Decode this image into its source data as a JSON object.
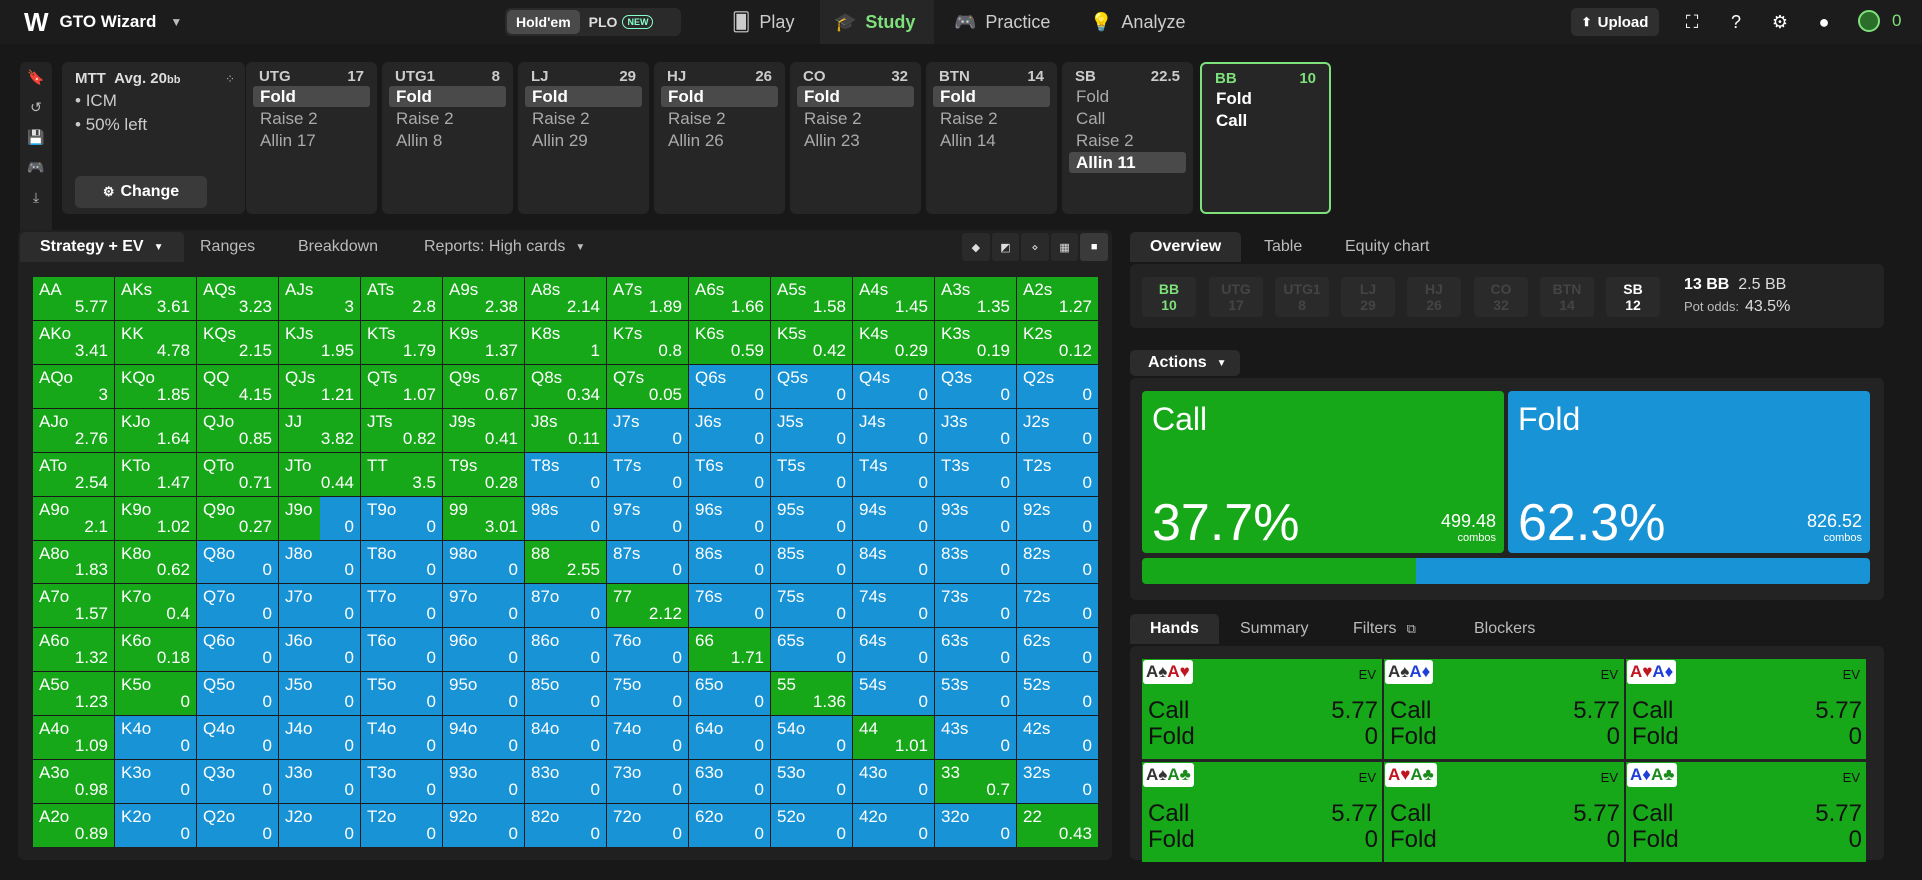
{
  "nav": {
    "logo": "W",
    "app_name": "GTO Wizard",
    "game_toggle": [
      "Hold'em",
      "PLO"
    ],
    "new_badge": "NEW",
    "items": [
      "Play",
      "Study",
      "Practice",
      "Analyze"
    ],
    "upload": "Upload",
    "coins": "0"
  },
  "mtt": {
    "title": "MTT",
    "avg": "Avg. 20",
    "avg_unit": "bb",
    "lines": [
      "ICM",
      "50% left"
    ],
    "change": "Change"
  },
  "positions": [
    {
      "name": "UTG",
      "stack": "17",
      "actions": [
        "Fold",
        "Raise 2",
        "Allin 17"
      ],
      "selected": 0
    },
    {
      "name": "UTG1",
      "stack": "8",
      "actions": [
        "Fold",
        "Raise 2",
        "Allin 8"
      ],
      "selected": 0
    },
    {
      "name": "LJ",
      "stack": "29",
      "actions": [
        "Fold",
        "Raise 2",
        "Allin 29"
      ],
      "selected": 0
    },
    {
      "name": "HJ",
      "stack": "26",
      "actions": [
        "Fold",
        "Raise 2",
        "Allin 26"
      ],
      "selected": 0
    },
    {
      "name": "CO",
      "stack": "32",
      "actions": [
        "Fold",
        "Raise 2",
        "Allin 23"
      ],
      "selected": 0
    },
    {
      "name": "BTN",
      "stack": "14",
      "actions": [
        "Fold",
        "Raise 2",
        "Allin 14"
      ],
      "selected": 0
    },
    {
      "name": "SB",
      "stack": "22.5",
      "actions": [
        "Fold",
        "Call",
        "Raise 2",
        "Allin 11"
      ],
      "selected": 3
    },
    {
      "name": "BB",
      "stack": "10",
      "actions": [
        "Fold",
        "Call"
      ],
      "selected": -1
    }
  ],
  "left_tabs": [
    "Strategy + EV",
    "Ranges",
    "Breakdown",
    "Reports: High cards"
  ],
  "colors": {
    "call": "#16a818",
    "fold": "#1893d6"
  },
  "grid": {
    "rows": [
      [
        [
          "AA",
          "5.77",
          1
        ],
        [
          "AKs",
          "3.61",
          1
        ],
        [
          "AQs",
          "3.23",
          1
        ],
        [
          "AJs",
          "3",
          1
        ],
        [
          "ATs",
          "2.8",
          1
        ],
        [
          "A9s",
          "2.38",
          1
        ],
        [
          "A8s",
          "2.14",
          1
        ],
        [
          "A7s",
          "1.89",
          1
        ],
        [
          "A6s",
          "1.66",
          1
        ],
        [
          "A5s",
          "1.58",
          1
        ],
        [
          "A4s",
          "1.45",
          1
        ],
        [
          "A3s",
          "1.35",
          1
        ],
        [
          "A2s",
          "1.27",
          1
        ]
      ],
      [
        [
          "AKo",
          "3.41",
          1
        ],
        [
          "KK",
          "4.78",
          1
        ],
        [
          "KQs",
          "2.15",
          1
        ],
        [
          "KJs",
          "1.95",
          1
        ],
        [
          "KTs",
          "1.79",
          1
        ],
        [
          "K9s",
          "1.37",
          1
        ],
        [
          "K8s",
          "1",
          1
        ],
        [
          "K7s",
          "0.8",
          1
        ],
        [
          "K6s",
          "0.59",
          1
        ],
        [
          "K5s",
          "0.42",
          1
        ],
        [
          "K4s",
          "0.29",
          1
        ],
        [
          "K3s",
          "0.19",
          1
        ],
        [
          "K2s",
          "0.12",
          1
        ]
      ],
      [
        [
          "AQo",
          "3",
          1
        ],
        [
          "KQo",
          "1.85",
          1
        ],
        [
          "QQ",
          "4.15",
          1
        ],
        [
          "QJs",
          "1.21",
          1
        ],
        [
          "QTs",
          "1.07",
          1
        ],
        [
          "Q9s",
          "0.67",
          1
        ],
        [
          "Q8s",
          "0.34",
          1
        ],
        [
          "Q7s",
          "0.05",
          1
        ],
        [
          "Q6s",
          "0",
          0
        ],
        [
          "Q5s",
          "0",
          0
        ],
        [
          "Q4s",
          "0",
          0
        ],
        [
          "Q3s",
          "0",
          0
        ],
        [
          "Q2s",
          "0",
          0
        ]
      ],
      [
        [
          "AJo",
          "2.76",
          1
        ],
        [
          "KJo",
          "1.64",
          1
        ],
        [
          "QJo",
          "0.85",
          1
        ],
        [
          "JJ",
          "3.82",
          1
        ],
        [
          "JTs",
          "0.82",
          1
        ],
        [
          "J9s",
          "0.41",
          1
        ],
        [
          "J8s",
          "0.11",
          1
        ],
        [
          "J7s",
          "0",
          0
        ],
        [
          "J6s",
          "0",
          0
        ],
        [
          "J5s",
          "0",
          0
        ],
        [
          "J4s",
          "0",
          0
        ],
        [
          "J3s",
          "0",
          0
        ],
        [
          "J2s",
          "0",
          0
        ]
      ],
      [
        [
          "ATo",
          "2.54",
          1
        ],
        [
          "KTo",
          "1.47",
          1
        ],
        [
          "QTo",
          "0.71",
          1
        ],
        [
          "JTo",
          "0.44",
          1
        ],
        [
          "TT",
          "3.5",
          1
        ],
        [
          "T9s",
          "0.28",
          1
        ],
        [
          "T8s",
          "0",
          0
        ],
        [
          "T7s",
          "0",
          0
        ],
        [
          "T6s",
          "0",
          0
        ],
        [
          "T5s",
          "0",
          0
        ],
        [
          "T4s",
          "0",
          0
        ],
        [
          "T3s",
          "0",
          0
        ],
        [
          "T2s",
          "0",
          0
        ]
      ],
      [
        [
          "A9o",
          "2.1",
          1
        ],
        [
          "K9o",
          "1.02",
          1
        ],
        [
          "Q9o",
          "0.27",
          1
        ],
        [
          "J9o",
          "0",
          0.5
        ],
        [
          "T9o",
          "0",
          0
        ],
        [
          "99",
          "3.01",
          1
        ],
        [
          "98s",
          "0",
          0
        ],
        [
          "97s",
          "0",
          0
        ],
        [
          "96s",
          "0",
          0
        ],
        [
          "95s",
          "0",
          0
        ],
        [
          "94s",
          "0",
          0
        ],
        [
          "93s",
          "0",
          0
        ],
        [
          "92s",
          "0",
          0
        ]
      ],
      [
        [
          "A8o",
          "1.83",
          1
        ],
        [
          "K8o",
          "0.62",
          1
        ],
        [
          "Q8o",
          "0",
          0
        ],
        [
          "J8o",
          "0",
          0
        ],
        [
          "T8o",
          "0",
          0
        ],
        [
          "98o",
          "0",
          0
        ],
        [
          "88",
          "2.55",
          1
        ],
        [
          "87s",
          "0",
          0
        ],
        [
          "86s",
          "0",
          0
        ],
        [
          "85s",
          "0",
          0
        ],
        [
          "84s",
          "0",
          0
        ],
        [
          "83s",
          "0",
          0
        ],
        [
          "82s",
          "0",
          0
        ]
      ],
      [
        [
          "A7o",
          "1.57",
          1
        ],
        [
          "K7o",
          "0.4",
          1
        ],
        [
          "Q7o",
          "0",
          0
        ],
        [
          "J7o",
          "0",
          0
        ],
        [
          "T7o",
          "0",
          0
        ],
        [
          "97o",
          "0",
          0
        ],
        [
          "87o",
          "0",
          0
        ],
        [
          "77",
          "2.12",
          1
        ],
        [
          "76s",
          "0",
          0
        ],
        [
          "75s",
          "0",
          0
        ],
        [
          "74s",
          "0",
          0
        ],
        [
          "73s",
          "0",
          0
        ],
        [
          "72s",
          "0",
          0
        ]
      ],
      [
        [
          "A6o",
          "1.32",
          1
        ],
        [
          "K6o",
          "0.18",
          1
        ],
        [
          "Q6o",
          "0",
          0
        ],
        [
          "J6o",
          "0",
          0
        ],
        [
          "T6o",
          "0",
          0
        ],
        [
          "96o",
          "0",
          0
        ],
        [
          "86o",
          "0",
          0
        ],
        [
          "76o",
          "0",
          0
        ],
        [
          "66",
          "1.71",
          1
        ],
        [
          "65s",
          "0",
          0
        ],
        [
          "64s",
          "0",
          0
        ],
        [
          "63s",
          "0",
          0
        ],
        [
          "62s",
          "0",
          0
        ]
      ],
      [
        [
          "A5o",
          "1.23",
          1
        ],
        [
          "K5o",
          "0",
          1
        ],
        [
          "Q5o",
          "0",
          0
        ],
        [
          "J5o",
          "0",
          0
        ],
        [
          "T5o",
          "0",
          0
        ],
        [
          "95o",
          "0",
          0
        ],
        [
          "85o",
          "0",
          0
        ],
        [
          "75o",
          "0",
          0
        ],
        [
          "65o",
          "0",
          0
        ],
        [
          "55",
          "1.36",
          1
        ],
        [
          "54s",
          "0",
          0
        ],
        [
          "53s",
          "0",
          0
        ],
        [
          "52s",
          "0",
          0
        ]
      ],
      [
        [
          "A4o",
          "1.09",
          1
        ],
        [
          "K4o",
          "0",
          0
        ],
        [
          "Q4o",
          "0",
          0
        ],
        [
          "J4o",
          "0",
          0
        ],
        [
          "T4o",
          "0",
          0
        ],
        [
          "94o",
          "0",
          0
        ],
        [
          "84o",
          "0",
          0
        ],
        [
          "74o",
          "0",
          0
        ],
        [
          "64o",
          "0",
          0
        ],
        [
          "54o",
          "0",
          0
        ],
        [
          "44",
          "1.01",
          1
        ],
        [
          "43s",
          "0",
          0
        ],
        [
          "42s",
          "0",
          0
        ]
      ],
      [
        [
          "A3o",
          "0.98",
          1
        ],
        [
          "K3o",
          "0",
          0
        ],
        [
          "Q3o",
          "0",
          0
        ],
        [
          "J3o",
          "0",
          0
        ],
        [
          "T3o",
          "0",
          0
        ],
        [
          "93o",
          "0",
          0
        ],
        [
          "83o",
          "0",
          0
        ],
        [
          "73o",
          "0",
          0
        ],
        [
          "63o",
          "0",
          0
        ],
        [
          "53o",
          "0",
          0
        ],
        [
          "43o",
          "0",
          0
        ],
        [
          "33",
          "0.7",
          1
        ],
        [
          "32s",
          "0",
          0
        ]
      ],
      [
        [
          "A2o",
          "0.89",
          1
        ],
        [
          "K2o",
          "0",
          0
        ],
        [
          "Q2o",
          "0",
          0
        ],
        [
          "J2o",
          "0",
          0
        ],
        [
          "T2o",
          "0",
          0
        ],
        [
          "92o",
          "0",
          0
        ],
        [
          "82o",
          "0",
          0
        ],
        [
          "72o",
          "0",
          0
        ],
        [
          "62o",
          "0",
          0
        ],
        [
          "52o",
          "0",
          0
        ],
        [
          "42o",
          "0",
          0
        ],
        [
          "32o",
          "0",
          0
        ],
        [
          "22",
          "0.43",
          1
        ]
      ]
    ]
  },
  "right_tabs": [
    "Overview",
    "Table",
    "Equity chart"
  ],
  "chips": [
    {
      "pos": "BB",
      "stack": "10"
    },
    {
      "pos": "UTG",
      "stack": "17"
    },
    {
      "pos": "UTG1",
      "stack": "8"
    },
    {
      "pos": "LJ",
      "stack": "29"
    },
    {
      "pos": "HJ",
      "stack": "26"
    },
    {
      "pos": "CO",
      "stack": "32"
    },
    {
      "pos": "BTN",
      "stack": "14"
    },
    {
      "pos": "SB",
      "stack": "12"
    }
  ],
  "pot": {
    "total": "13 BB",
    "to_call": "2.5 BB",
    "odds_label": "Pot odds:",
    "odds": "43.5%"
  },
  "actions_label": "Actions",
  "actions": [
    {
      "name": "Call",
      "pct": "37.7%",
      "combos": "499.48",
      "combos_label": "combos",
      "freq": 0.377
    },
    {
      "name": "Fold",
      "pct": "62.3%",
      "combos": "826.52",
      "combos_label": "combos",
      "freq": 0.623
    }
  ],
  "hand_tabs": [
    "Hands",
    "Summary",
    "Filters",
    "Blockers"
  ],
  "hands": [
    {
      "rank1": "A",
      "suit1": "♠",
      "rank2": "A",
      "suit2": "♥",
      "ev": "EV",
      "call_label": "Call",
      "call": "5.77",
      "fold_label": "Fold",
      "fold": "0"
    },
    {
      "rank1": "A",
      "suit1": "♠",
      "rank2": "A",
      "suit2": "♦",
      "ev": "EV",
      "call_label": "Call",
      "call": "5.77",
      "fold_label": "Fold",
      "fold": "0"
    },
    {
      "rank1": "A",
      "suit1": "♥",
      "rank2": "A",
      "suit2": "♦",
      "ev": "EV",
      "call_label": "Call",
      "call": "5.77",
      "fold_label": "Fold",
      "fold": "0"
    },
    {
      "rank1": "A",
      "suit1": "♠",
      "rank2": "A",
      "suit2": "♣",
      "ev": "EV",
      "call_label": "Call",
      "call": "5.77",
      "fold_label": "Fold",
      "fold": "0"
    },
    {
      "rank1": "A",
      "suit1": "♥",
      "rank2": "A",
      "suit2": "♣",
      "ev": "EV",
      "call_label": "Call",
      "call": "5.77",
      "fold_label": "Fold",
      "fold": "0"
    },
    {
      "rank1": "A",
      "suit1": "♦",
      "rank2": "A",
      "suit2": "♣",
      "ev": "EV",
      "call_label": "Call",
      "call": "5.77",
      "fold_label": "Fold",
      "fold": "0"
    }
  ]
}
